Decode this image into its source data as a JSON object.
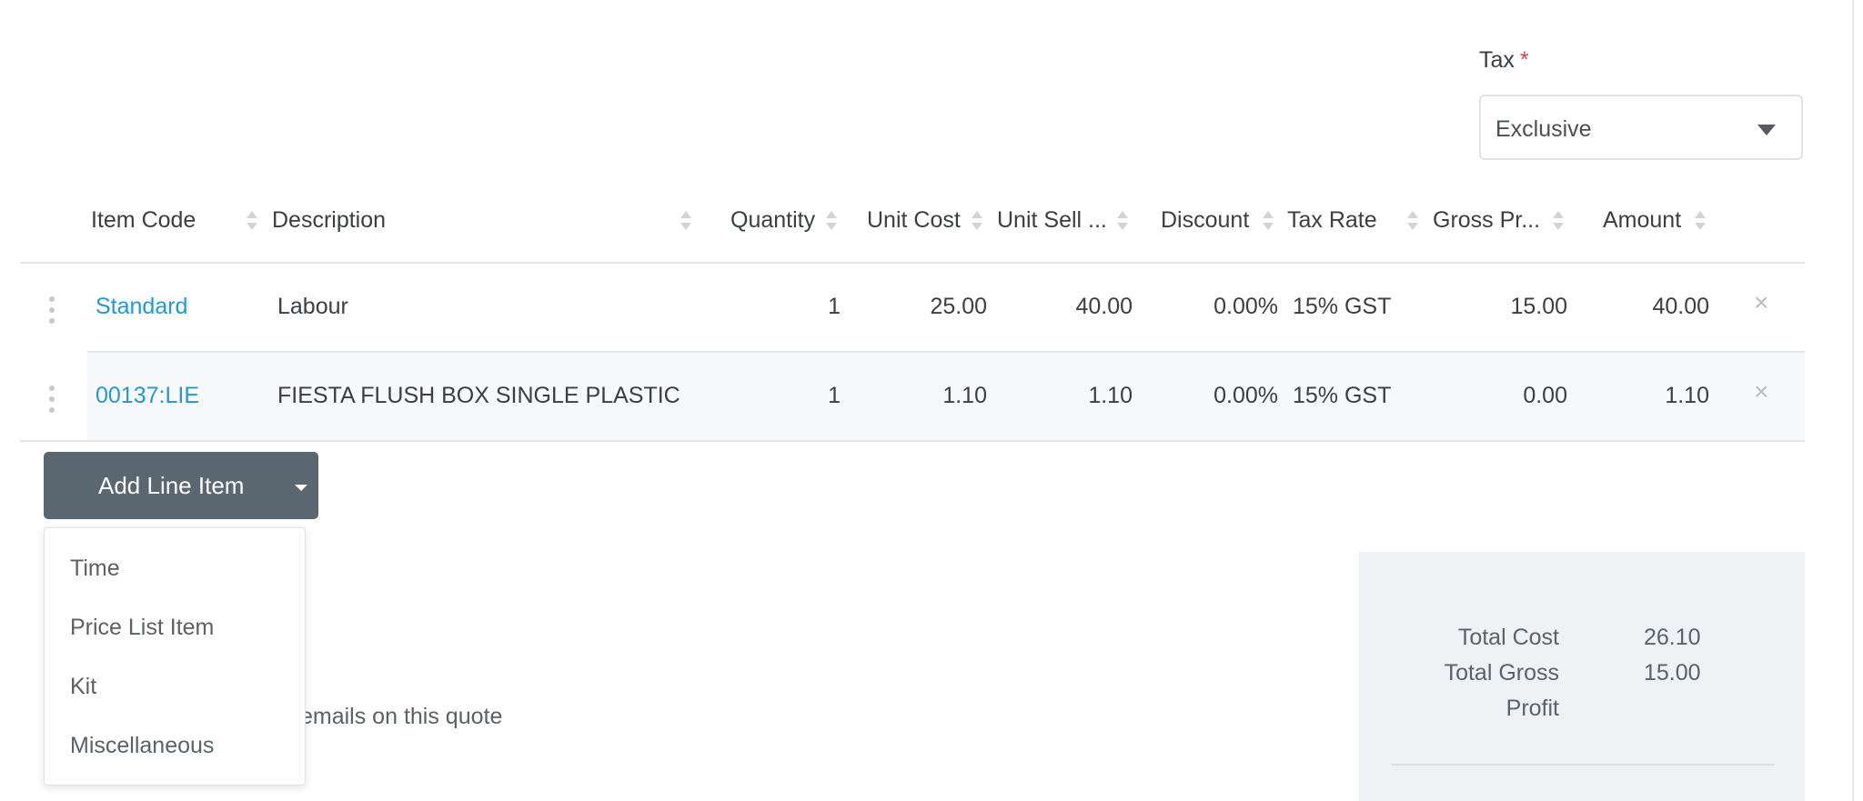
{
  "tax": {
    "label": "Tax",
    "required_mark": "*",
    "selected": "Exclusive"
  },
  "table": {
    "columns": {
      "item_code": "Item Code",
      "description": "Description",
      "quantity": "Quantity",
      "unit_cost": "Unit Cost",
      "unit_sell": "Unit Sell ...",
      "discount": "Discount",
      "tax_rate": "Tax Rate",
      "gross_profit": "Gross Pr...",
      "amount": "Amount"
    },
    "rows": [
      {
        "item_code": "Standard",
        "description": "Labour",
        "quantity": "1",
        "unit_cost": "25.00",
        "unit_sell": "40.00",
        "discount": "0.00%",
        "tax_rate": "15% GST",
        "gross_profit": "15.00",
        "amount": "40.00",
        "remove": "×"
      },
      {
        "item_code": "00137:LIE",
        "description": "FIESTA FLUSH BOX SINGLE PLASTIC",
        "quantity": "1",
        "unit_cost": "1.10",
        "unit_sell": "1.10",
        "discount": "0.00%",
        "tax_rate": "15% GST",
        "gross_profit": "0.00",
        "amount": "1.10",
        "remove": "×"
      }
    ]
  },
  "add_line_item": {
    "label": "Add Line Item",
    "menu": [
      "Time",
      "Price List Item",
      "Kit",
      "Miscellaneous"
    ]
  },
  "partial_text": "emails on this quote",
  "totals": {
    "total_cost_label": "Total Cost",
    "total_cost_value": "26.10",
    "total_gross_profit_label_line1": "Total Gross",
    "total_gross_profit_label_line2": "Profit",
    "total_gross_profit_value": "15.00"
  },
  "colors": {
    "link": "#1f9ad6",
    "button_bg": "#5a6670",
    "required": "#e0443c",
    "totals_bg": "#eef2f5",
    "row_alt_bg": "#f7f9fa"
  }
}
